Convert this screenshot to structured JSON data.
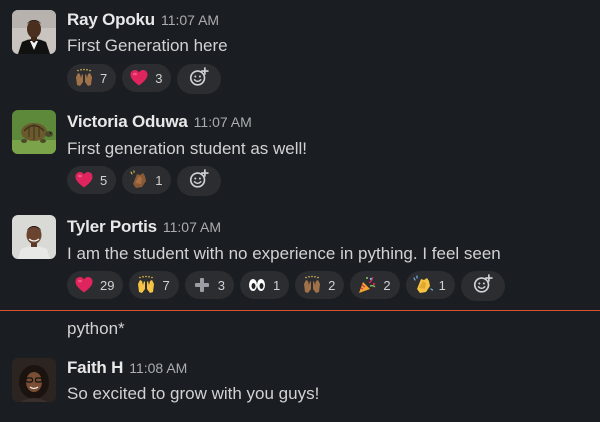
{
  "messages": [
    {
      "name": "Ray Opoku",
      "time": "11:07 AM",
      "text": "First Generation here",
      "reactions": [
        {
          "emoji": "raising-hands-dark-icon",
          "count": "7"
        },
        {
          "emoji": "red-heart-icon",
          "count": "3"
        }
      ]
    },
    {
      "name": "Victoria Oduwa",
      "time": "11:07 AM",
      "text": "First generation student as well!",
      "reactions": [
        {
          "emoji": "red-heart-icon",
          "count": "5"
        },
        {
          "emoji": "clapping-hands-dark-icon",
          "count": "1"
        }
      ]
    },
    {
      "name": "Tyler Portis",
      "time": "11:07 AM",
      "text": "I am the student with no experience in pything. I feel seen",
      "reactions": [
        {
          "emoji": "red-heart-icon",
          "count": "29"
        },
        {
          "emoji": "raising-hands-icon",
          "count": "7"
        },
        {
          "emoji": "plus-icon",
          "count": "3"
        },
        {
          "emoji": "eyes-icon",
          "count": "1"
        },
        {
          "emoji": "raising-hands-dark-icon",
          "count": "2"
        },
        {
          "emoji": "party-popper-icon",
          "count": "2"
        },
        {
          "emoji": "clapping-hands-icon",
          "count": "1"
        }
      ]
    },
    {
      "name": "",
      "time": "",
      "text": "python*",
      "reactions": []
    },
    {
      "name": "Faith H",
      "time": "11:08 AM",
      "text": "So excited to grow with you guys!",
      "reactions": []
    }
  ],
  "colors": {
    "background": "#1a1d21",
    "pill": "#2c2d30",
    "new_divider": "#d8502f"
  }
}
